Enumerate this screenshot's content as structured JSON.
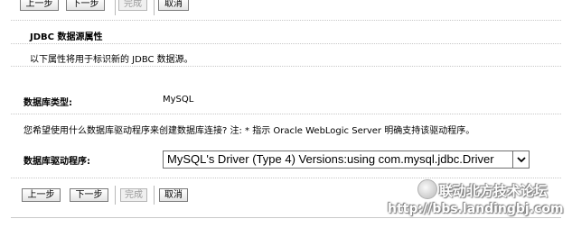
{
  "toolbar_top": {
    "back_label": "上一步",
    "next_label": "下一步",
    "finish_label": "完成",
    "cancel_label": "取消"
  },
  "section": {
    "title": "JDBC 数据源属性",
    "description": "以下属性将用于标识新的 JDBC 数据源。"
  },
  "db_type": {
    "label": "数据库类型:",
    "value": "MySQL"
  },
  "driver_question": "您希望使用什么数据库驱动程序来创建数据库连接? 注: * 指示 Oracle WebLogic Server 明确支持该驱动程序。",
  "driver": {
    "label": "数据库驱动程序:",
    "selected": "MySQL's Driver (Type 4) Versions:using com.mysql.jdbc.Driver"
  },
  "toolbar_bottom": {
    "back_label": "上一步",
    "next_label": "下一步",
    "finish_label": "完成",
    "cancel_label": "取消"
  },
  "watermark": {
    "title": "联动北方技术论坛",
    "url": "http://bbs.landingbj.com"
  },
  "icons": {
    "dropdown": "chevron-down-icon",
    "watermark_logo": "forum-logo-icon"
  }
}
